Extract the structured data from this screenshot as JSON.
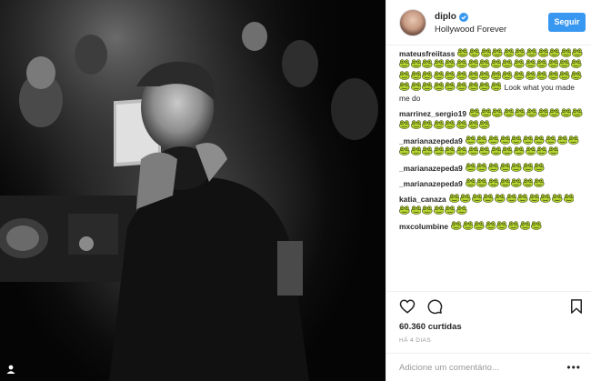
{
  "post": {
    "image_alt": "",
    "header": {
      "username": "diplo",
      "location": "Hollywood Forever",
      "follow_label": "Seguir"
    },
    "comments": [
      {
        "user": "mateusfreiitass",
        "emoji": "🐸",
        "emoji_count": 52,
        "text": "Look what you made me do"
      },
      {
        "user": "marrinez_sergio19",
        "emoji": "🐸",
        "emoji_count": 18,
        "text": ""
      },
      {
        "user": "_marianazepeda9",
        "emoji": "🐸",
        "emoji_count": 24,
        "text": ""
      },
      {
        "user": "_marianazepeda9",
        "emoji": "🐸",
        "emoji_count": 7,
        "text": ""
      },
      {
        "user": "_marianazepeda9",
        "emoji": "🐸",
        "emoji_count": 7,
        "text": ""
      },
      {
        "user": "katia_canaza",
        "emoji": "🐸",
        "emoji_count": 17,
        "text": ""
      },
      {
        "user": "mxcolumbine",
        "emoji": "🐸",
        "emoji_count": 8,
        "text": ""
      }
    ],
    "likes_label": "60.360 curtidas",
    "date_label": "HÁ 4 DIAS",
    "add_comment_placeholder": "Adicione um comentário...",
    "more_label": "•••",
    "icons": {
      "like": "heart-icon",
      "comment": "comment-bubble-icon",
      "save": "bookmark-icon",
      "verified": "verified-badge-icon",
      "corner": "tag-icon"
    },
    "colors": {
      "accent": "#3897f0",
      "text": "#262626",
      "muted": "#999999",
      "emoji_green": "#b7d631",
      "emoji_dark": "#3f4a17"
    }
  }
}
